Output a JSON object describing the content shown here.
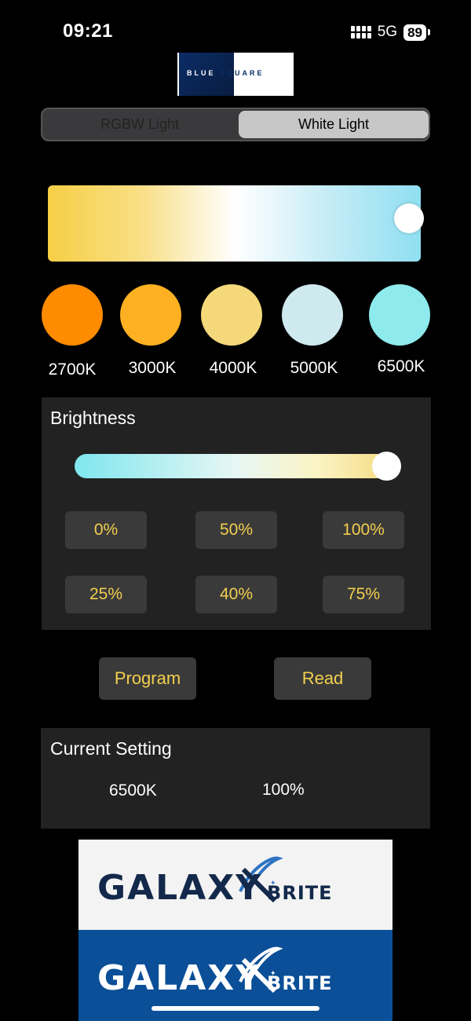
{
  "status_bar": {
    "time": "09:21",
    "network": "5G",
    "battery": "89"
  },
  "brand_logo": {
    "text_light": "BLUE",
    "text_dark": "SQUARE"
  },
  "mode_tabs": {
    "items": [
      {
        "label": "RGBW Light",
        "selected": false
      },
      {
        "label": "White Light",
        "selected": true
      }
    ]
  },
  "color_temperature": {
    "slider_value": 1.0,
    "presets": [
      {
        "label": "2700K",
        "color": "#ff8c00"
      },
      {
        "label": "3000K",
        "color": "#fdb122"
      },
      {
        "label": "4000K",
        "color": "#f4d87a"
      },
      {
        "label": "5000K",
        "color": "#cfeaef"
      },
      {
        "label": "6500K",
        "color": "#8eeaec"
      }
    ]
  },
  "brightness": {
    "title": "Brightness",
    "slider_value": 1.0,
    "buttons": [
      "0%",
      "50%",
      "100%",
      "25%",
      "40%",
      "75%"
    ]
  },
  "actions": {
    "program": "Program",
    "read": "Read"
  },
  "current_setting": {
    "title": "Current Setting",
    "temperature": "6500K",
    "brightness": "100%"
  },
  "galaxy_brite": {
    "main": "GALAXY",
    "sub": "BRITE"
  },
  "colors": {
    "accent_text": "#f2cf4f",
    "panel_bg": "#222222",
    "button_bg": "#3a3a3a",
    "brand_blue": "#0a4f97",
    "brand_navy": "#13294b"
  }
}
